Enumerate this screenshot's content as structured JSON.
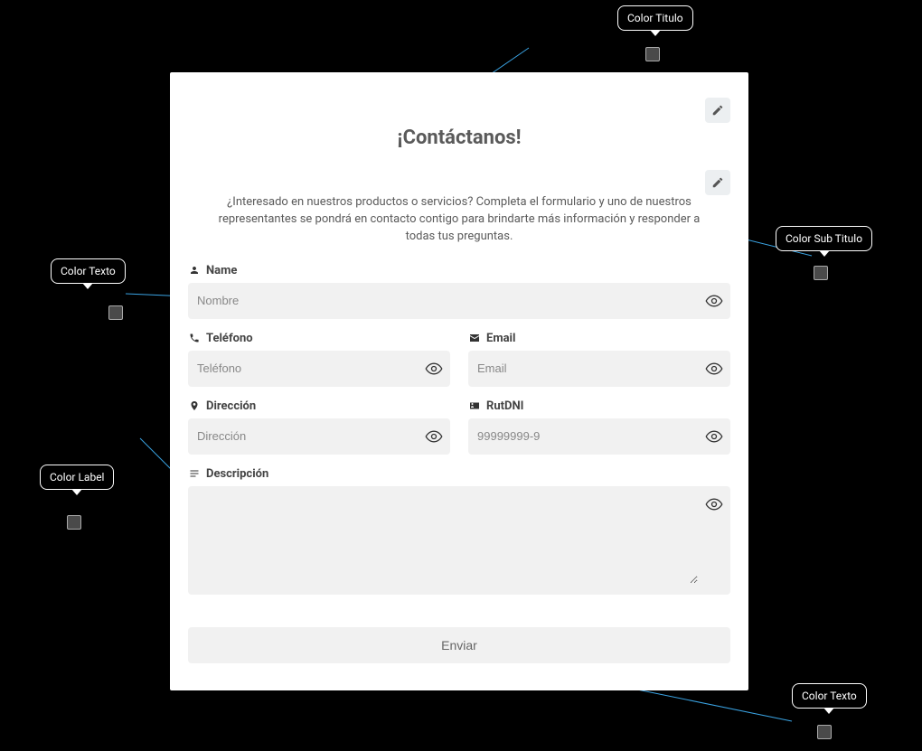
{
  "title": "¡Contáctanos!",
  "subtitle": "¿Interesado en nuestros productos o servicios? Completa el formulario y uno de nuestros representantes se pondrá en contacto contigo para brindarte más información y responder a todas tus preguntas.",
  "fields": {
    "name": {
      "label": "Name",
      "placeholder": "Nombre"
    },
    "phone": {
      "label": "Teléfono",
      "placeholder": "Teléfono"
    },
    "email": {
      "label": "Email",
      "placeholder": "Email"
    },
    "address": {
      "label": "Dirección",
      "placeholder": "Dirección"
    },
    "rutdni": {
      "label": "RutDNI",
      "placeholder": "99999999-9"
    },
    "description": {
      "label": "Descripción",
      "placeholder": ""
    }
  },
  "submit_label": "Enviar",
  "tooltips": {
    "titulo": "Color Titulo",
    "subtitulo": "Color Sub Titulo",
    "texto1": "Color Texto",
    "label": "Color Label",
    "texto2": "Color Texto"
  },
  "swatch_color": "#4a4a4a"
}
